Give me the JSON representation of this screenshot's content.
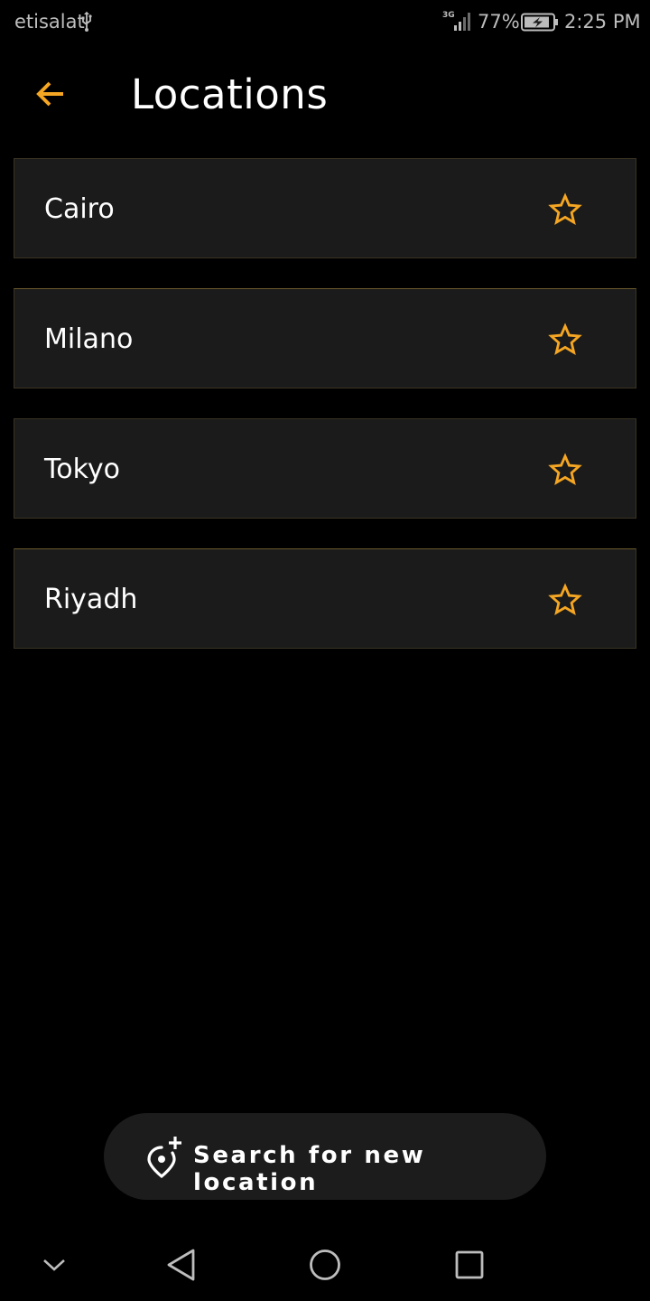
{
  "status_bar": {
    "carrier": "etisalat",
    "network_type": "3G",
    "battery_percent": "77%",
    "time": "2:25 PM",
    "icons": [
      "usb-icon",
      "signal-icon",
      "battery-charging-icon"
    ]
  },
  "header": {
    "title": "Locations",
    "back_icon": "arrow-left-icon"
  },
  "locations": [
    {
      "name": "Cairo",
      "favorite": false
    },
    {
      "name": "Milano",
      "favorite": false
    },
    {
      "name": "Tokyo",
      "favorite": false
    },
    {
      "name": "Riyadh",
      "favorite": false
    }
  ],
  "search_button": {
    "label": "Search for new location",
    "icon": "add-location-icon"
  },
  "nav_bar": {
    "icons": [
      "chevron-down-icon",
      "back-triangle-icon",
      "home-circle-icon",
      "recents-square-icon"
    ]
  },
  "colors": {
    "accent": "#f5a623",
    "background": "#000000",
    "card": "#1b1b1b",
    "text": "#ffffff"
  }
}
